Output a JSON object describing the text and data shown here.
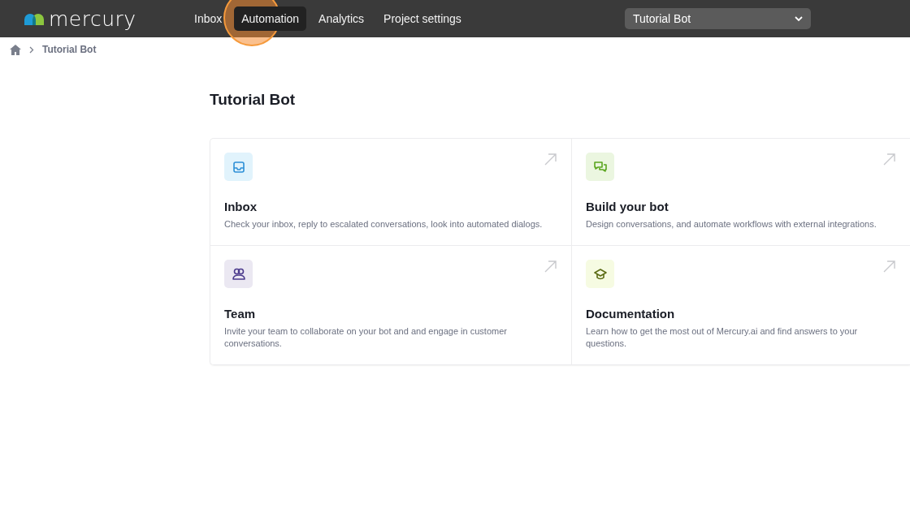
{
  "logo": {
    "text": "mercury"
  },
  "nav": [
    {
      "label": "Inbox",
      "selected": false
    },
    {
      "label": "Automation",
      "selected": true
    },
    {
      "label": "Analytics",
      "selected": false
    },
    {
      "label": "Project settings",
      "selected": false
    }
  ],
  "project_select": {
    "value": "Tutorial Bot"
  },
  "breadcrumb": {
    "current": "Tutorial Bot"
  },
  "page_title": "Tutorial Bot",
  "cards": [
    {
      "kind": "inbox",
      "title": "Inbox",
      "description": "Check your inbox, reply to escalated conversations, look into automated dialogs."
    },
    {
      "kind": "chat",
      "title": "Build your bot",
      "description": "Design conversations, and automate workflows with external integrations."
    },
    {
      "kind": "team",
      "title": "Team",
      "description": "Invite your team to collaborate on your bot and and engage in customer conversations."
    },
    {
      "kind": "docs",
      "title": "Documentation",
      "description": "Learn how to get the most out of Mercury.ai and find answers to your questions."
    }
  ]
}
